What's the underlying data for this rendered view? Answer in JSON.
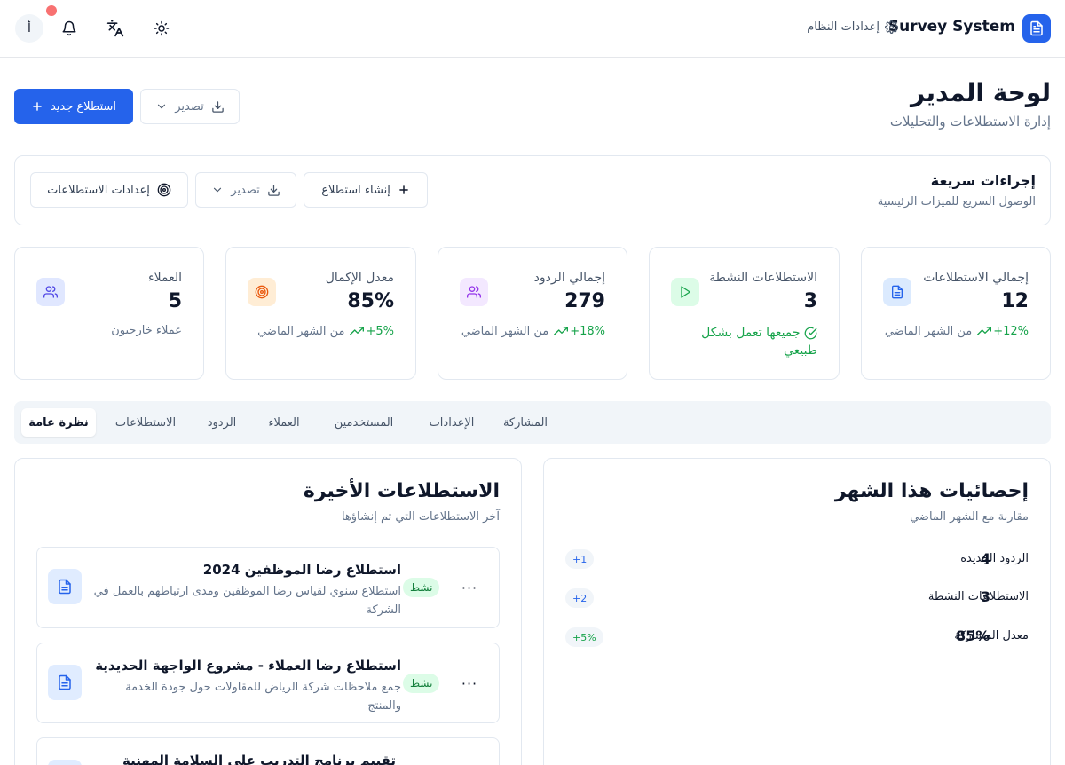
{
  "header": {
    "brand_title": "Survey System",
    "settings_label": "إعدادات النظام",
    "avatar_initial": "أ"
  },
  "page": {
    "title": "لوحة المدير",
    "subtitle": "إدارة الاستطلاعات والتحليلات",
    "new_survey_label": "استطلاع جديد",
    "export_label": "تصدير"
  },
  "quick_actions": {
    "title": "إجراءات سريعة",
    "subtitle": "الوصول السريع للميزات الرئيسية",
    "create_label": "إنشاء استطلاع",
    "export_label": "تصدير",
    "settings_label": "إعدادات الاستطلاعات"
  },
  "stats": [
    {
      "title": "إجمالي الاستطلاعات",
      "value": "12",
      "delta": "+12%",
      "foot": "من الشهر الماضي"
    },
    {
      "title": "الاستطلاعات النشطة",
      "value": "3",
      "foot": "جميعها تعمل بشكل طبيعي"
    },
    {
      "title": "إجمالي الردود",
      "value": "279",
      "delta": "+18%",
      "foot": "من الشهر الماضي"
    },
    {
      "title": "معدل الإكمال",
      "value": "85%",
      "delta": "+5%",
      "foot": "من الشهر الماضي"
    },
    {
      "title": "العملاء",
      "value": "5",
      "foot": "عملاء خارجيون"
    }
  ],
  "tabs": [
    "نظرة عامة",
    "الاستطلاعات",
    "الردود",
    "العملاء",
    "المستخدمين",
    "الإعدادات",
    "المشاركة"
  ],
  "recent_surveys": {
    "title": "الاستطلاعات الأخيرة",
    "subtitle": "آخر الاستطلاعات التي تم إنشاؤها",
    "items": [
      {
        "name": "استطلاع رضا الموظفين 2024",
        "description": "استطلاع سنوي لقياس رضا الموظفين ومدى ارتباطهم بالعمل في الشركة",
        "status": "نشط"
      },
      {
        "name": "استطلاع رضا العملاء - مشروع الواجهة الحديدية",
        "description": "جمع ملاحظات شركة الرياض للمقاولات حول جودة الخدمة والمنتج",
        "status": "نشط"
      },
      {
        "name": "تقييم برنامج التدريب على السلامة المهنية"
      }
    ],
    "more_glyph": "···"
  },
  "month_stats": {
    "title": "إحصائيات هذا الشهر",
    "subtitle": "مقارنة مع الشهر الماضي",
    "rows": [
      {
        "label": "الردود الجديدة",
        "value": "4",
        "badge": "+1"
      },
      {
        "label": "الاستطلاعات النشطة",
        "value": "3",
        "badge": "+2"
      },
      {
        "label": "معدل المشاركة",
        "value": "85%",
        "badge": "+5%"
      }
    ]
  },
  "colors": {
    "primary": "#2563eb",
    "success": "#16a34a",
    "notification": "#f87171",
    "border": "#e2e8f0"
  },
  "icons": {
    "brand": "file-text-icon",
    "settings": "gear-icon",
    "notifications": "bell-icon",
    "language": "translate-icon",
    "theme": "sun-icon",
    "stats": [
      "file-text-icon",
      "play-icon",
      "users-icon",
      "target-icon",
      "users-icon"
    ]
  }
}
